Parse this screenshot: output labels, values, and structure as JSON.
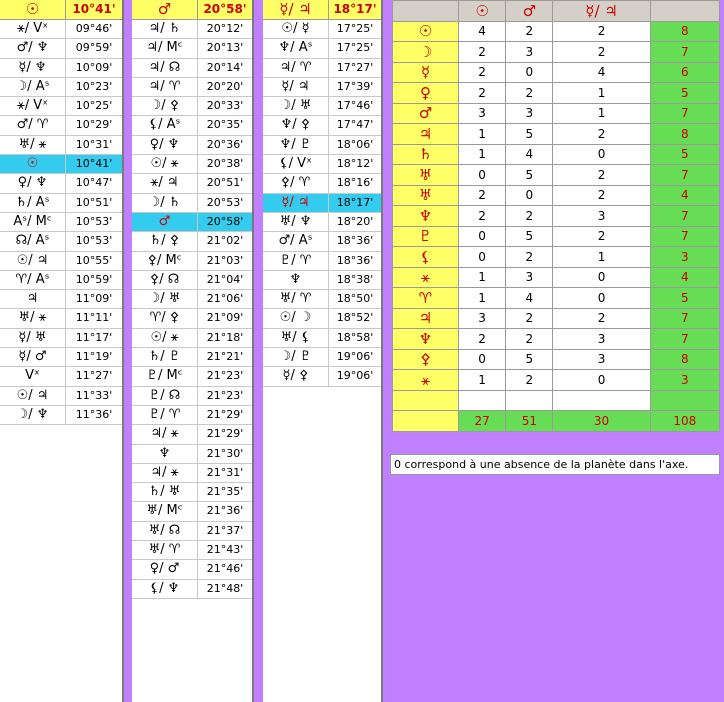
{
  "panels": [
    {
      "symbol": "☉",
      "degree": "10°41'",
      "rows": [
        {
          "a": "⚹/ Vˣ",
          "b": "09°46'"
        },
        {
          "a": "♂/ ♆",
          "b": "09°59'"
        },
        {
          "a": "☿/ ♆",
          "b": "10°09'"
        },
        {
          "a": "☽/ Aˢ",
          "b": "10°23'"
        },
        {
          "a": "⚹/ Vˣ",
          "b": "10°25'"
        },
        {
          "a": "♂/ ♈",
          "b": "10°29'"
        },
        {
          "a": "♅/ ⚹",
          "b": "10°31'"
        },
        {
          "a": "☉",
          "b": "10°41'",
          "hl": true
        },
        {
          "a": "♀/ ♆",
          "b": "10°47'"
        },
        {
          "a": "♄/ Aˢ",
          "b": "10°51'"
        },
        {
          "a": "Aˢ/ Mᶜ",
          "b": "10°53'"
        },
        {
          "a": "☊/ Aˢ",
          "b": "10°53'"
        },
        {
          "a": "☉/ ♃",
          "b": "10°55'"
        },
        {
          "a": "♈/ Aˢ",
          "b": "10°59'"
        },
        {
          "a": "♃",
          "b": "11°09'"
        },
        {
          "a": "♅/ ⚹",
          "b": "11°11'"
        },
        {
          "a": "☿/ ♅",
          "b": "11°17'"
        },
        {
          "a": "☿/ ♂",
          "b": "11°19'"
        },
        {
          "a": "Vˣ",
          "b": "11°27'"
        },
        {
          "a": "☉/ ♃",
          "b": "11°33'"
        },
        {
          "a": "☽/ ♆",
          "b": "11°36'"
        }
      ]
    },
    {
      "symbol": "♂",
      "degree": "20°58'",
      "rows": [
        {
          "a": "♃/ ♄",
          "b": "20°12'"
        },
        {
          "a": "♃/ Mᶜ",
          "b": "20°13'"
        },
        {
          "a": "♃/ ☊",
          "b": "20°14'"
        },
        {
          "a": "♃/ ♈",
          "b": "20°20'"
        },
        {
          "a": "☽/ ⚴",
          "b": "20°33'"
        },
        {
          "a": "⚸/ Aˢ",
          "b": "20°35'"
        },
        {
          "a": "♀/ ♆",
          "b": "20°36'"
        },
        {
          "a": "☉/ ⚹",
          "b": "20°38'"
        },
        {
          "a": "⚹/ ♃",
          "b": "20°51'"
        },
        {
          "a": "☽/ ♄",
          "b": "20°53'"
        },
        {
          "a": "♂",
          "b": "20°58'",
          "hl": true
        },
        {
          "a": "♄/ ⚴",
          "b": "21°02'"
        },
        {
          "a": "⚴/ Mᶜ",
          "b": "21°03'"
        },
        {
          "a": "⚴/ ☊",
          "b": "21°04'"
        },
        {
          "a": "☽/ ♅",
          "b": "21°06'"
        },
        {
          "a": "♈/ ⚴",
          "b": "21°09'"
        },
        {
          "a": "☉/ ⚹",
          "b": "21°18'"
        },
        {
          "a": "♄/ ♇",
          "b": "21°21'"
        },
        {
          "a": "♇/ Mᶜ",
          "b": "21°23'"
        },
        {
          "a": "♇/ ☊",
          "b": "21°23'"
        },
        {
          "a": "♇/ ♈",
          "b": "21°29'"
        },
        {
          "a": "♃/ ⚹",
          "b": "21°29'"
        },
        {
          "a": "♆",
          "b": "21°30'"
        },
        {
          "a": "♃/ ⚹",
          "b": "21°31'"
        },
        {
          "a": "♄/ ♅",
          "b": "21°35'"
        },
        {
          "a": "♅/ Mᶜ",
          "b": "21°36'"
        },
        {
          "a": "♅/ ☊",
          "b": "21°37'"
        },
        {
          "a": "♅/ ♈",
          "b": "21°43'"
        },
        {
          "a": "♀/ ♂",
          "b": "21°46'"
        },
        {
          "a": "⚸/ ♆",
          "b": "21°48'"
        }
      ]
    },
    {
      "symbol": "☿/ ♃",
      "degree": "18°17'",
      "rows": [
        {
          "a": "☉/ ☿",
          "b": "17°25'"
        },
        {
          "a": "♆/ Aˢ",
          "b": "17°25'"
        },
        {
          "a": "♃/ ♈",
          "b": "17°27'"
        },
        {
          "a": "☿/ ♃",
          "b": "17°39'"
        },
        {
          "a": "☽/ ♅",
          "b": "17°46'"
        },
        {
          "a": "♆/ ⚴",
          "b": "17°47'"
        },
        {
          "a": "♆/ ♇",
          "b": "18°06'"
        },
        {
          "a": "⚸/ Vˣ",
          "b": "18°12'"
        },
        {
          "a": "⚴/ ♈",
          "b": "18°16'"
        },
        {
          "a": "☿/ ♃",
          "b": "18°17'",
          "hl": true
        },
        {
          "a": "♅/ ♆",
          "b": "18°20'"
        },
        {
          "a": "♂/ Aˢ",
          "b": "18°36'"
        },
        {
          "a": "♇/ ♈",
          "b": "18°36'"
        },
        {
          "a": "♆",
          "b": "18°38'"
        },
        {
          "a": "♅/ ♈",
          "b": "18°50'"
        },
        {
          "a": "☉/ ☽",
          "b": "18°52'"
        },
        {
          "a": "♅/ ⚸",
          "b": "18°58'"
        },
        {
          "a": "☽/ ♇",
          "b": "19°06'"
        },
        {
          "a": "☿/ ⚴",
          "b": "19°06'"
        }
      ]
    }
  ],
  "table": {
    "headers": [
      "☉",
      "♂",
      "☿/ ♃"
    ],
    "rows": [
      {
        "planet": "☉",
        "v": [
          4,
          2,
          2
        ],
        "t": 8
      },
      {
        "planet": "☽",
        "v": [
          2,
          3,
          2
        ],
        "t": 7
      },
      {
        "planet": "☿",
        "v": [
          2,
          0,
          4
        ],
        "t": 6
      },
      {
        "planet": "♀",
        "v": [
          2,
          2,
          1
        ],
        "t": 5
      },
      {
        "planet": "♂",
        "v": [
          3,
          3,
          1
        ],
        "t": 7
      },
      {
        "planet": "♃",
        "v": [
          1,
          5,
          2
        ],
        "t": 8
      },
      {
        "planet": "♄",
        "v": [
          1,
          4,
          0
        ],
        "t": 5
      },
      {
        "planet": "♅",
        "v": [
          0,
          5,
          2
        ],
        "t": 7
      },
      {
        "planet": "♅",
        "v": [
          2,
          0,
          2
        ],
        "t": 4
      },
      {
        "planet": "♆",
        "v": [
          2,
          2,
          3
        ],
        "t": 7
      },
      {
        "planet": "♇",
        "v": [
          0,
          5,
          2
        ],
        "t": 7
      },
      {
        "planet": "⚸",
        "v": [
          0,
          2,
          1
        ],
        "t": 3
      },
      {
        "planet": "⚹",
        "v": [
          1,
          3,
          0
        ],
        "t": 4
      },
      {
        "planet": "♈",
        "v": [
          1,
          4,
          0
        ],
        "t": 5
      },
      {
        "planet": "♃",
        "v": [
          3,
          2,
          2
        ],
        "t": 7
      },
      {
        "planet": "♆",
        "v": [
          2,
          2,
          3
        ],
        "t": 7
      },
      {
        "planet": "⚴",
        "v": [
          0,
          5,
          3
        ],
        "t": 8
      },
      {
        "planet": "⚹",
        "v": [
          1,
          2,
          0
        ],
        "t": 3
      }
    ],
    "sums": [
      27,
      51,
      30,
      108
    ]
  },
  "note": "0 correspond à une absence de la planète dans l'axe."
}
